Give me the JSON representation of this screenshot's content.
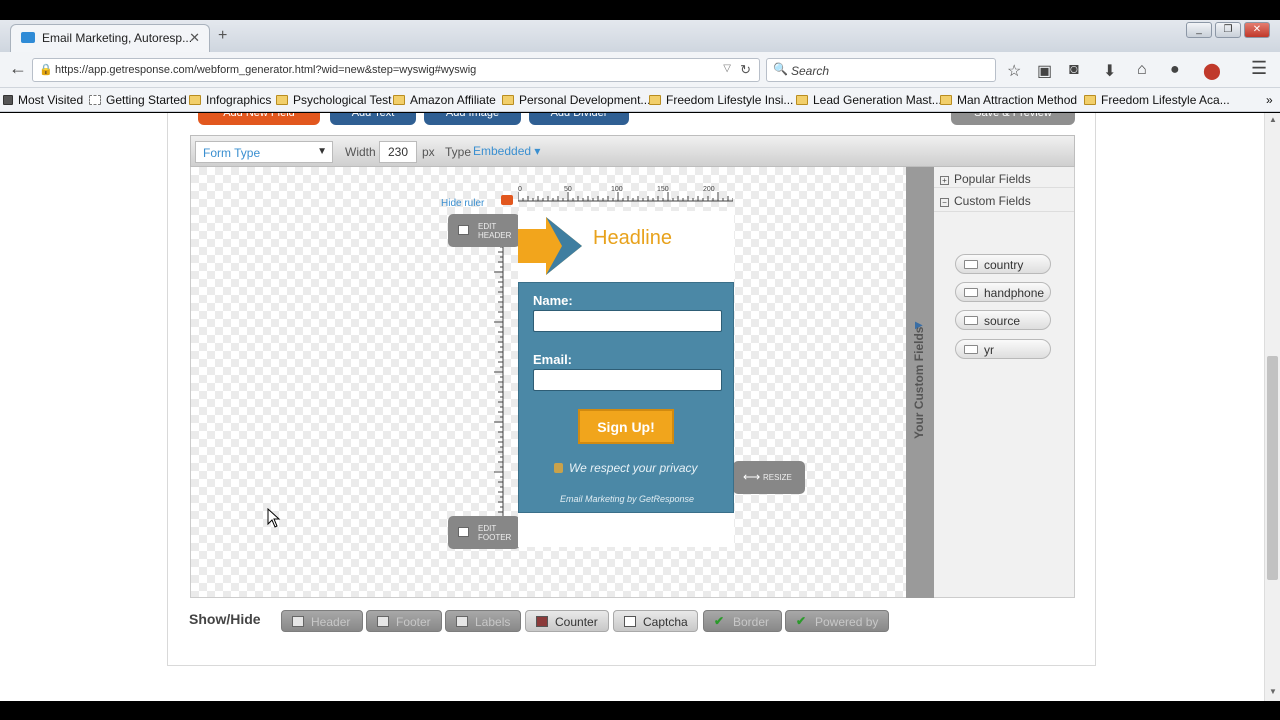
{
  "browser": {
    "tab_title": "Email Marketing, Autoresp...",
    "tab_close": "✕",
    "new_tab": "+",
    "url": "https://app.getresponse.com/webform_generator.html?wid=new&step=wyswig#wyswig",
    "search_placeholder": "Search",
    "bookmarks": [
      "Most Visited",
      "Getting Started",
      "Infographics",
      "Psychological Test",
      "Amazon Affiliate",
      "Personal Development...",
      "Freedom Lifestyle Insi...",
      "Lead Generation Mast...",
      "Man Attraction Method",
      "Freedom Lifestyle Aca..."
    ]
  },
  "top_buttons": {
    "add_field": "Add New Field",
    "add_text": "Add Text",
    "add_image": "Add Image",
    "add_divider": "Add Divider",
    "save_preview": "Save & Preview"
  },
  "toolbar": {
    "form_type_placeholder": "Form Type",
    "width_label": "Width",
    "width_value": "230",
    "width_unit": "px",
    "type_label": "Type",
    "type_value": "Embedded ▾"
  },
  "ruler": {
    "hide_label": "Hide ruler",
    "h_ticks": [
      "0",
      "50",
      "100",
      "150",
      "200"
    ]
  },
  "form_preview": {
    "headline": "Headline",
    "name_label": "Name:",
    "email_label": "Email:",
    "signup_label": "Sign Up!",
    "privacy_text": "We respect your privacy",
    "credit_text": "Email Marketing by GetResponse",
    "edit_header": [
      "EDIT",
      "HEADER"
    ],
    "edit_footer": [
      "EDIT",
      "FOOTER"
    ],
    "resize": "RESIZE"
  },
  "side_panel": {
    "vertical_label": "Your Custom Fields",
    "popular_fields": "Popular Fields",
    "custom_fields": "Custom Fields",
    "custom_field_items": [
      "country",
      "handphone",
      "source",
      "yr"
    ]
  },
  "show_hide": {
    "label": "Show/Hide",
    "buttons": [
      "Header",
      "Footer",
      "Labels",
      "Counter",
      "Captcha",
      "Border",
      "Powered by"
    ]
  },
  "colors": {
    "form_body": "#4b88a6",
    "signup_button": "#f1a51c",
    "headline": "#e8a21c",
    "add_field_button": "#e2571e",
    "blue_button": "#2f5f93"
  }
}
